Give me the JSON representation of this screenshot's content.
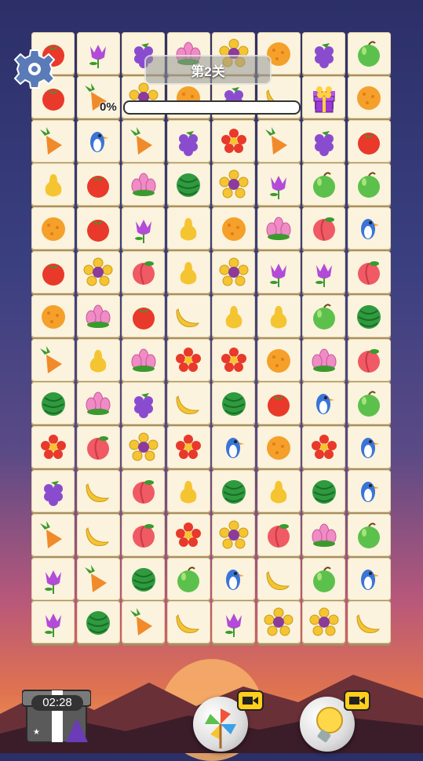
{
  "level": {
    "label": "第2关"
  },
  "progress": {
    "label": "0%",
    "value": 0
  },
  "timer": {
    "label": "02:28"
  },
  "tiles": [
    [
      "tomato",
      "tulip",
      "grape",
      "lotus",
      "sunflower",
      "orange",
      "grape",
      "apple"
    ],
    [
      "tomato",
      "carrot",
      "sunflower",
      "orange",
      "grape",
      "banana",
      "gift",
      "orange"
    ],
    [
      "carrot",
      "bluebird",
      "carrot",
      "grape",
      "poppy",
      "carrot",
      "grape",
      "tomato"
    ],
    [
      "pear",
      "tomato",
      "lotus",
      "melon",
      "sunflower",
      "tulip",
      "apple",
      "apple"
    ],
    [
      "orange",
      "tomato",
      "tulip",
      "pear",
      "orange",
      "lotus",
      "peach",
      "bluebird"
    ],
    [
      "tomato",
      "sunflower",
      "peach",
      "pear",
      "sunflower",
      "tulip",
      "tulip",
      "peach"
    ],
    [
      "orange",
      "lotus",
      "tomato",
      "banana",
      "pear",
      "pear",
      "apple",
      "melon"
    ],
    [
      "carrot",
      "pear",
      "lotus",
      "poppy",
      "poppy",
      "orange",
      "lotus",
      "peach"
    ],
    [
      "melon",
      "lotus",
      "grape",
      "banana",
      "melon",
      "tomato",
      "bluebird",
      "apple"
    ],
    [
      "poppy",
      "peach",
      "sunflower",
      "poppy",
      "bluebird",
      "orange",
      "poppy",
      "bluebird"
    ],
    [
      "grape",
      "banana",
      "peach",
      "pear",
      "melon",
      "pear",
      "melon",
      "bluebird"
    ],
    [
      "carrot",
      "banana",
      "peach",
      "poppy",
      "sunflower",
      "peach",
      "lotus",
      "apple"
    ],
    [
      "tulip",
      "carrot",
      "melon",
      "apple",
      "bluebird",
      "banana",
      "apple",
      "bluebird"
    ],
    [
      "tulip",
      "melon",
      "carrot",
      "banana",
      "tulip",
      "sunflower",
      "sunflower",
      "banana"
    ]
  ],
  "icons": {
    "settings": "gear-icon",
    "gift": "gift-box-icon",
    "shuffle": "pinwheel-icon",
    "hint": "lightbulb-icon",
    "video": "video-camera-icon"
  }
}
